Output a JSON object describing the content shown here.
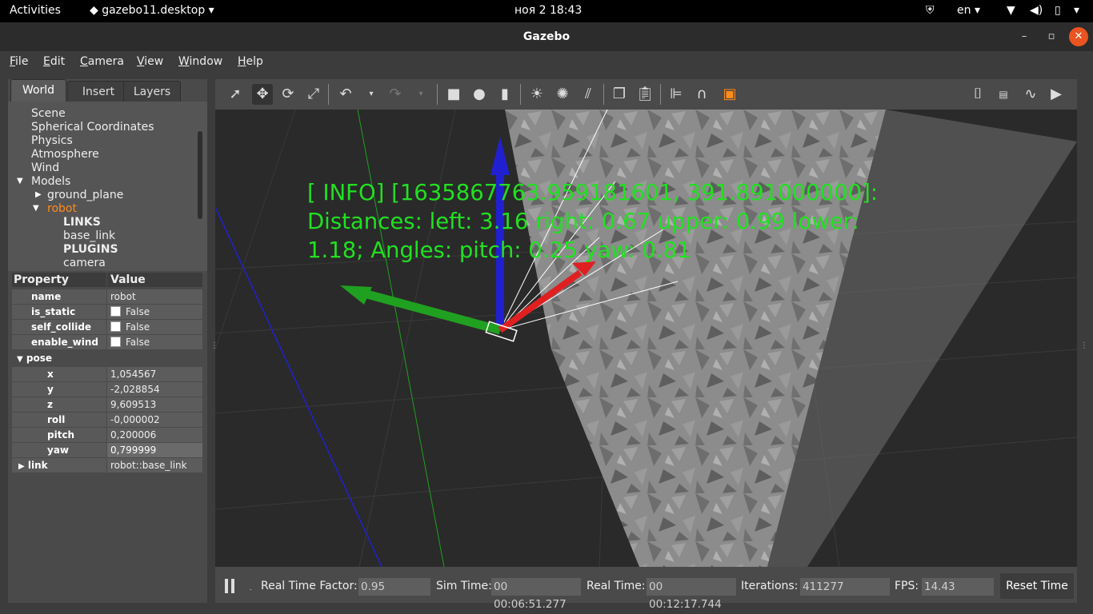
{
  "topbar": {
    "activities": "Activities",
    "app": "gazebo11.desktop",
    "clock": "ноя 2  18:43",
    "lang": "en"
  },
  "window": {
    "title": "Gazebo"
  },
  "menu": [
    "File",
    "Edit",
    "Camera",
    "View",
    "Window",
    "Help"
  ],
  "left_tabs": [
    "World",
    "Insert",
    "Layers"
  ],
  "tree": {
    "items": [
      "Scene",
      "Spherical Coordinates",
      "Physics",
      "Atmosphere",
      "Wind",
      "Models"
    ],
    "models": [
      "ground_plane",
      "robot"
    ],
    "robot_children": [
      "LINKS",
      "base_link",
      "PLUGINS",
      "camera"
    ]
  },
  "props": {
    "header": [
      "Property",
      "Value"
    ],
    "name": {
      "key": "name",
      "value": "robot"
    },
    "is_static": {
      "key": "is_static",
      "value": "False"
    },
    "self_collide": {
      "key": "self_collide",
      "value": "False"
    },
    "enable_wind": {
      "key": "enable_wind",
      "value": "False"
    },
    "pose": "pose",
    "x": {
      "key": "x",
      "value": "1,054567"
    },
    "y": {
      "key": "y",
      "value": "-2,028854"
    },
    "z": {
      "key": "z",
      "value": "9,609513"
    },
    "roll": {
      "key": "roll",
      "value": "-0,000002"
    },
    "pitch": {
      "key": "pitch",
      "value": "0,200006"
    },
    "yaw": {
      "key": "yaw",
      "value": "0,799999"
    },
    "link": {
      "key": "link",
      "value": "robot::base_link"
    }
  },
  "overlay_text": "[ INFO] [1635867763.959181601, 391.891000000]: Distances: left: 3.16 right: 0.67 upper: 0.99 lower: 1.18; Angles: pitch: 0.25 yaw: 0.81",
  "bottom": {
    "rtf_label": "Real Time Factor:",
    "rtf": "0.95",
    "sim_label": "Sim Time:",
    "sim": "00 00:06:51.277",
    "real_label": "Real Time:",
    "real": "00 00:12:17.744",
    "iter_label": "Iterations:",
    "iter": "411277",
    "fps_label": "FPS:",
    "fps": "14.43",
    "reset": "Reset Time"
  },
  "colors": {
    "overlay": "#22e022",
    "selected": "#ff8c1a",
    "x_axis": "#e02020",
    "y_axis": "#20a020",
    "z_axis": "#2020d0"
  }
}
